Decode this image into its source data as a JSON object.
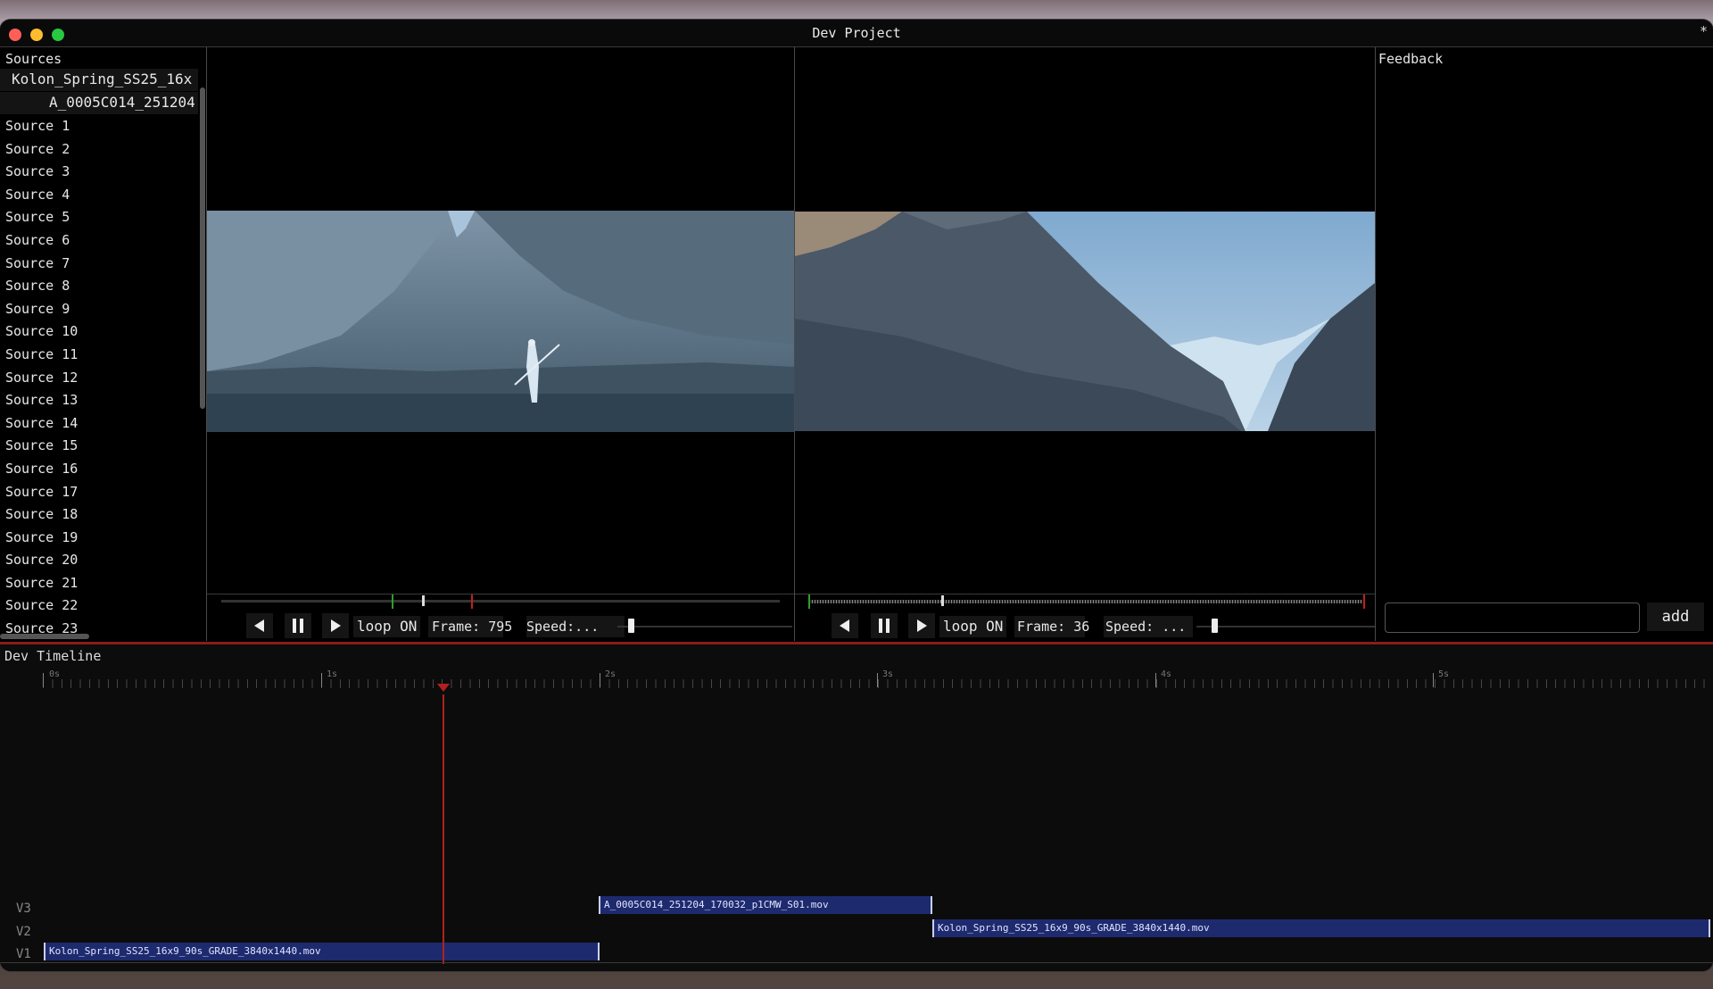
{
  "window": {
    "title": "Dev Project",
    "modified_marker": "*"
  },
  "sources": {
    "title": "Sources",
    "selected_parent": "Kolon_Spring_SS25_16x",
    "selected_child": "A_0005C014_251204",
    "items": [
      "Source 1",
      "Source 2",
      "Source 3",
      "Source 4",
      "Source 5",
      "Source 6",
      "Source 7",
      "Source 8",
      "Source 9",
      "Source 10",
      "Source 11",
      "Source 12",
      "Source 13",
      "Source 14",
      "Source 15",
      "Source 16",
      "Source 17",
      "Source 18",
      "Source 19",
      "Source 20",
      "Source 21",
      "Source 22",
      "Source 23"
    ]
  },
  "viewer_left": {
    "loop_label": "loop ON",
    "frame_text": "Frame: 795",
    "speed_text": "Speed:..."
  },
  "viewer_right": {
    "loop_label": "loop ON",
    "frame_text": "Frame: 36",
    "speed_text": "Speed: ..."
  },
  "feedback": {
    "title": "Feedback",
    "input_value": "",
    "add_label": "add"
  },
  "timeline": {
    "title": "Dev Timeline",
    "ruler_labels": [
      "0s",
      "1s",
      "2s",
      "3s",
      "4s",
      "5s"
    ],
    "tracks": [
      "V3",
      "V2",
      "V1"
    ],
    "clips": {
      "v3": "A_0005C014_251204_170032_p1CMW_S01.mov",
      "v2": "Kolon_Spring_SS25_16x9_90s_GRADE_3840x1440.mov",
      "v1": "Kolon_Spring_SS25_16x9_90s_GRADE_3840x1440.mov"
    }
  },
  "colors": {
    "clip_fill": "#1e2a6e",
    "playhead": "#b22020",
    "in_marker": "#2aa02a",
    "out_marker": "#c02020"
  },
  "icons": [
    "prev-frame-icon",
    "pause-icon",
    "play-icon"
  ]
}
